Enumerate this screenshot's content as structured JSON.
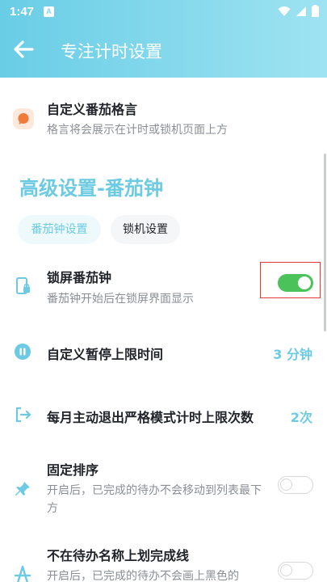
{
  "status_bar": {
    "time": "1:47",
    "notification_badge": "A"
  },
  "header": {
    "title": "专注计时设置"
  },
  "motto": {
    "title": "自定义番茄格言",
    "subtitle": "格言将会展示在计时或锁机页面上方"
  },
  "section": {
    "title": "高级设置-番茄钟"
  },
  "tabs": [
    {
      "label": "番茄钟设置",
      "active": true
    },
    {
      "label": "锁机设置",
      "active": false
    }
  ],
  "lock_screen": {
    "title": "锁屏番茄钟",
    "subtitle": "番茄钟开始后在锁屏界面显示",
    "enabled": true
  },
  "pause_limit": {
    "title": "自定义暂停上限时间",
    "value": "3 分钟"
  },
  "exit_limit": {
    "title": "每月主动退出严格模式计时上限次数",
    "value": "2次"
  },
  "fixed_order": {
    "title": "固定排序",
    "subtitle": "开启后，已完成的待办不会移动到列表最下方",
    "enabled": false
  },
  "no_strikethrough": {
    "title": "不在待办名称上划完成线",
    "subtitle": "开启后，已完成的待办不会画上黑色的",
    "enabled": false
  },
  "colors": {
    "accent": "#6ccbe3",
    "toggle_on": "#4cc35a",
    "header_start": "#69cde6",
    "header_end": "#9ee3f2"
  }
}
